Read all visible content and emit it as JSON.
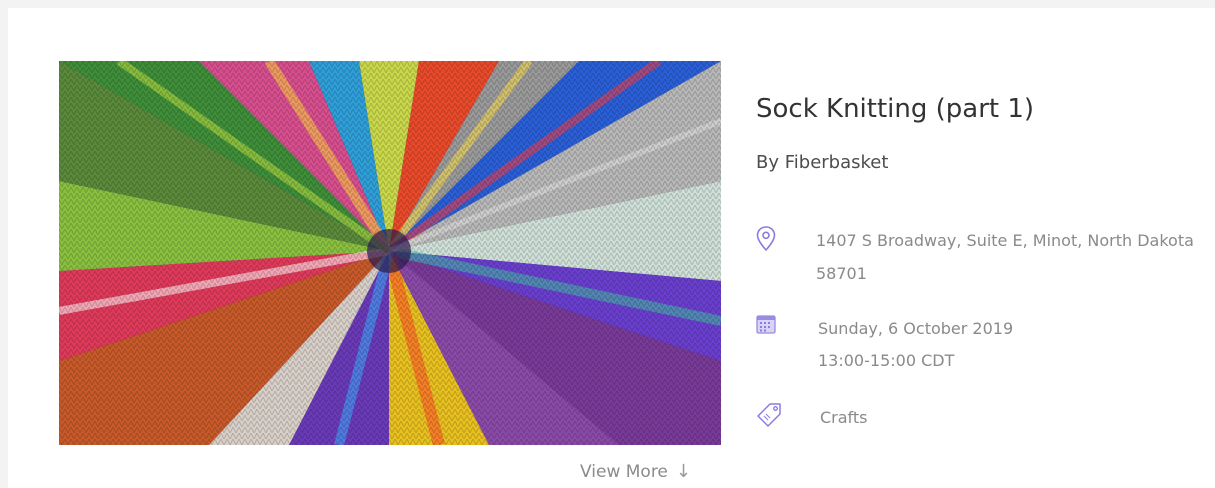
{
  "event": {
    "title": "Sock Knitting (part 1)",
    "author": "By Fiberbasket",
    "address_line1": "1407 S Broadway, Suite E, Minot, North Dakota",
    "address_line2": "58701",
    "date": "Sunday, 6 October 2019",
    "time": "13:00-15:00 CDT",
    "category": "Crafts",
    "view_more_label": "View More",
    "view_more_arrow": "↓"
  },
  "icons": {
    "location": "map-pin-icon",
    "date": "calendar-icon",
    "category": "tag-icon"
  },
  "colors": {
    "accent_purple": "#8c7be0",
    "text_dark": "#333333",
    "text_muted": "#8a8a8a"
  }
}
